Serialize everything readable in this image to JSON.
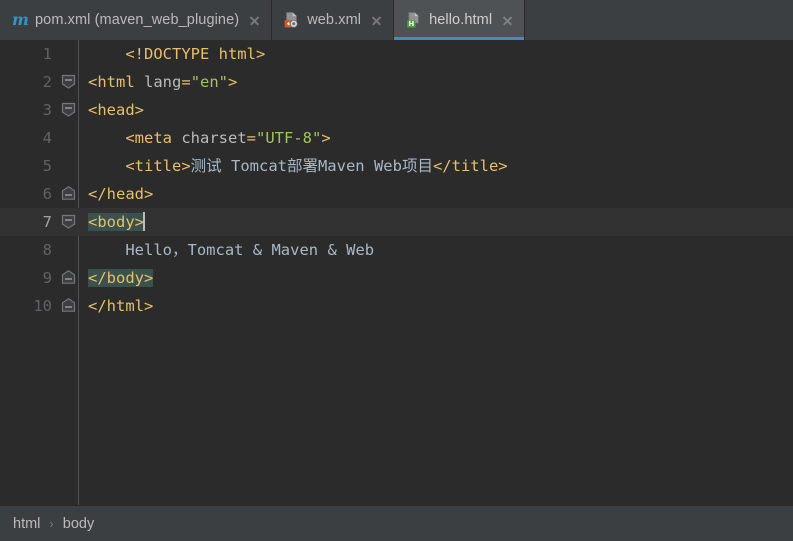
{
  "tabs": [
    {
      "label": "pom.xml (maven_web_plugine)",
      "icon": "maven-icon",
      "active": false,
      "close": "close-icon"
    },
    {
      "label": "web.xml",
      "icon": "xml-file-icon",
      "active": false,
      "close": "close-icon"
    },
    {
      "label": "hello.html",
      "icon": "html-file-icon",
      "active": true,
      "close": "close-icon"
    }
  ],
  "editor": {
    "current_line": 7,
    "lines": [
      {
        "n": "1",
        "fold": "none",
        "text": "    <!DOCTYPE html>"
      },
      {
        "n": "2",
        "fold": "open",
        "text": "<html lang=\"en\">"
      },
      {
        "n": "3",
        "fold": "open",
        "text": "<head>"
      },
      {
        "n": "4",
        "fold": "none",
        "text": "    <meta charset=\"UTF-8\">"
      },
      {
        "n": "5",
        "fold": "none",
        "text": "    <title>测试 Tomcat部署Maven Web项目</title>"
      },
      {
        "n": "6",
        "fold": "close",
        "text": "</head>"
      },
      {
        "n": "7",
        "fold": "open",
        "text": "<body>"
      },
      {
        "n": "8",
        "fold": "none",
        "text": "    Hello，Tomcat & Maven & Web"
      },
      {
        "n": "9",
        "fold": "close",
        "text": "</body>"
      },
      {
        "n": "10",
        "fold": "close",
        "text": "</html>"
      }
    ]
  },
  "breadcrumb": {
    "items": [
      "html",
      "body"
    ],
    "separator": "›"
  },
  "colors": {
    "editor_background": "#2b2b2b",
    "current_line": "#323232",
    "tabbar_background": "#3c3f41",
    "active_tab_background": "#4e5254",
    "active_tab_underline": "#4a88c7",
    "tag": "#e8bf6a",
    "attribute_value": "#a5c261",
    "attribute_name": "#bababa",
    "plain_text": "#a9b7c6",
    "match_highlight": "#3b514d",
    "line_number": "#606366",
    "maven_icon": "#3592c4",
    "xml_badge": "#cc5c29",
    "html_badge": "#4f9b3f"
  }
}
